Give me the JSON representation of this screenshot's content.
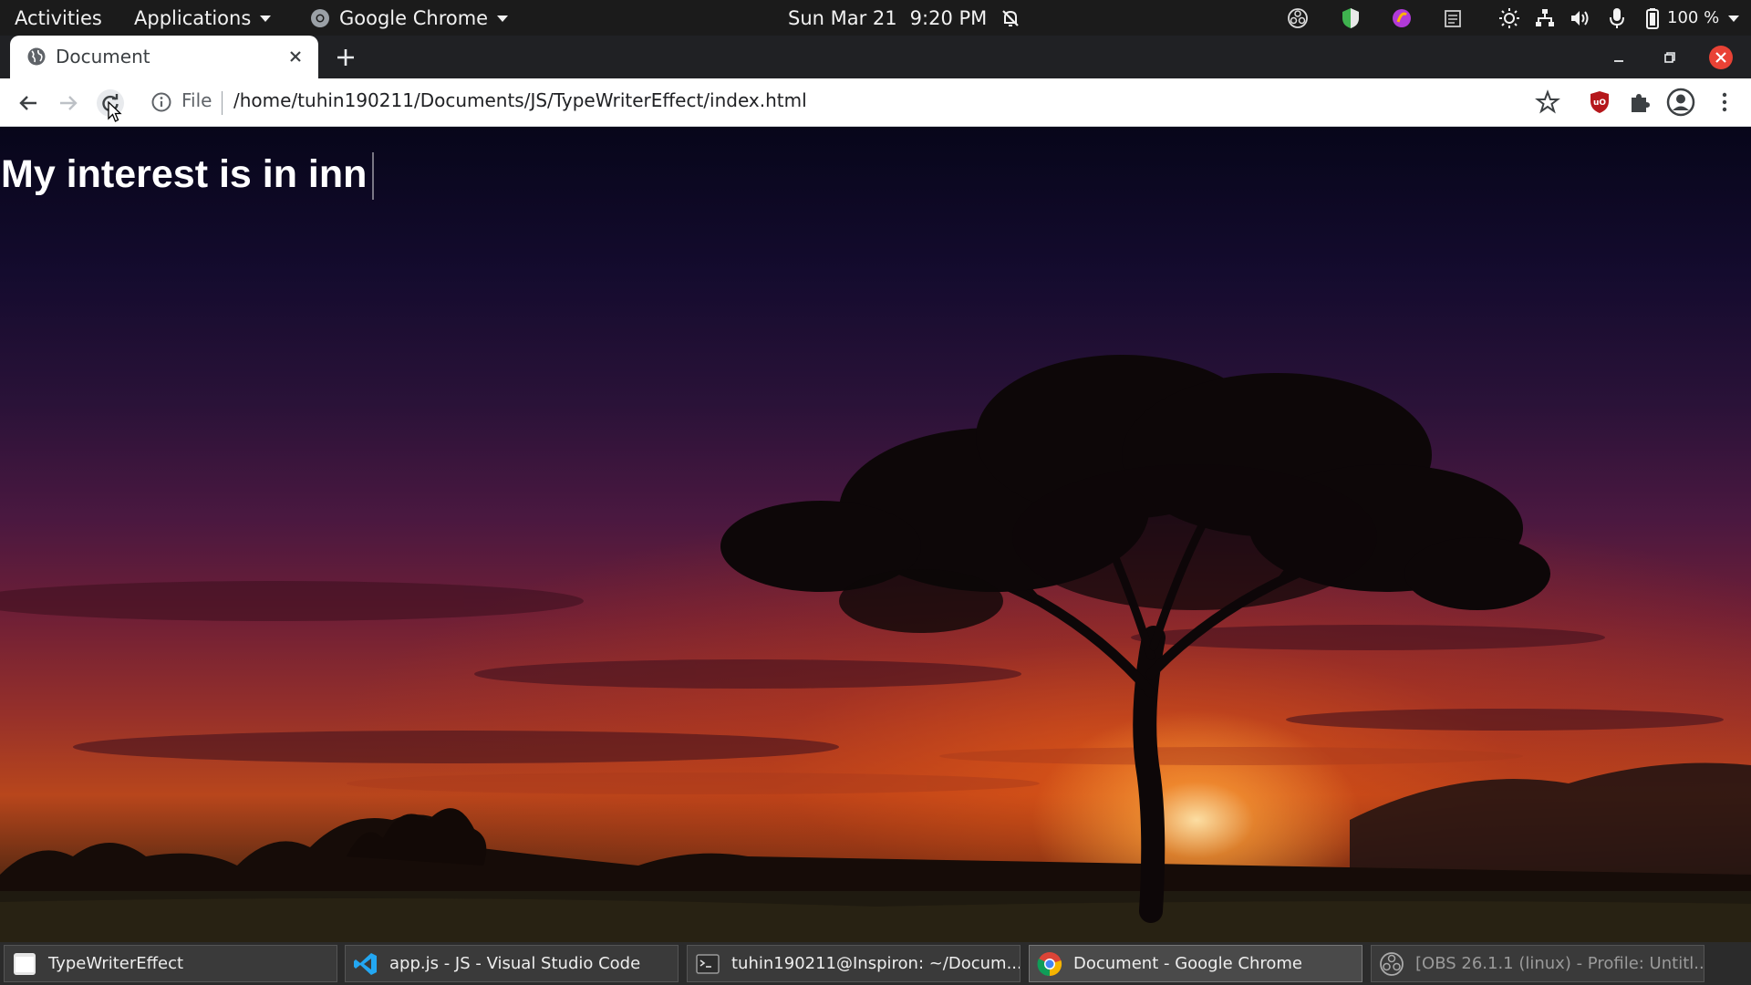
{
  "topbar": {
    "activities": "Activities",
    "applications": "Applications",
    "app_menu": "Google Chrome",
    "date": "Sun Mar 21",
    "time": "9:20 PM",
    "battery": "100 %"
  },
  "browser": {
    "tab_title": "Document",
    "omnibox_scheme": "File",
    "url": "/home/tuhin190211/Documents/JS/TypeWriterEffect/index.html"
  },
  "page": {
    "typed_text": "My interest is in inn"
  },
  "taskbar": {
    "items": [
      {
        "label": "TypeWriterEffect"
      },
      {
        "label": "app.js - JS - Visual Studio Code"
      },
      {
        "label": "tuhin190211@Inspiron: ~/Docum..."
      },
      {
        "label": "Document - Google Chrome"
      },
      {
        "label": "[OBS 26.1.1 (linux) - Profile: Untitl..."
      }
    ]
  },
  "colors": {
    "topbar_bg": "#1b1b1b",
    "tabstrip_bg": "#202124",
    "close_button": "#e94235",
    "ublock_red": "#b5171b"
  }
}
